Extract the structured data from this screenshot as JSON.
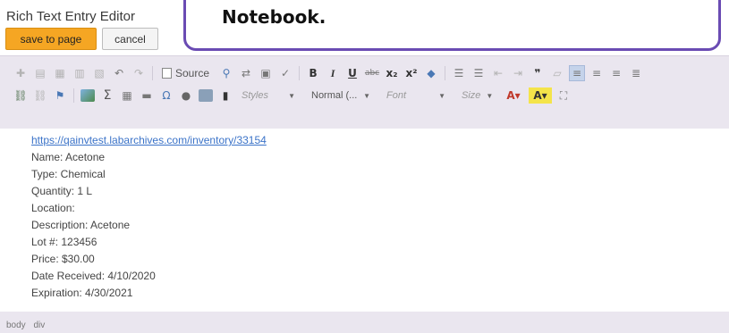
{
  "header": {
    "title": "Rich Text Entry Editor",
    "save_label": "save to page",
    "cancel_label": "cancel"
  },
  "callout": {
    "text": "Notebook."
  },
  "toolbar": {
    "source_label": "Source",
    "styles_label": "Styles",
    "format_label": "Normal (...",
    "font_label": "Font",
    "size_label": "Size",
    "row1_icons": [
      "paste-icon",
      "paste-text-icon",
      "paste-word-icon",
      "undo-icon",
      "redo-icon",
      "source-icon",
      "find-icon",
      "replace-icon",
      "select-all-icon",
      "spellcheck-icon",
      "bold-icon",
      "italic-icon",
      "underline-icon",
      "strikethrough-icon",
      "subscript-icon",
      "superscript-icon",
      "remove-format-icon",
      "numbered-list-icon",
      "bulleted-list-icon",
      "outdent-icon",
      "indent-icon",
      "blockquote-icon",
      "div-icon",
      "align-left-icon",
      "align-center-icon",
      "align-right-icon",
      "justify-icon"
    ],
    "row2_icons": [
      "link-icon",
      "unlink-icon",
      "anchor-icon",
      "image-icon",
      "sum-icon",
      "table-icon",
      "horizontal-line-icon",
      "special-char-icon",
      "smiley-icon",
      "iframe-icon",
      "page-break-icon",
      "text-color-icon",
      "background-color-icon",
      "maximize-icon"
    ]
  },
  "content": {
    "lines": [
      "https://qainvtest.labarchives.com/inventory/33154",
      "Name: Acetone",
      "Type: Chemical",
      "Quantity: 1 L",
      "Location:",
      "Description: Acetone",
      "Lot #: 123456",
      "Price: $30.00",
      "Date Received: 4/10/2020",
      "Expiration: 4/30/2021"
    ]
  },
  "statusbar": {
    "path": [
      "body",
      "div"
    ]
  },
  "colors": {
    "accent": "#f5a623",
    "callout_border": "#6a4bb3",
    "link": "#3b73c8",
    "editor_bg": "#eae6ef"
  }
}
